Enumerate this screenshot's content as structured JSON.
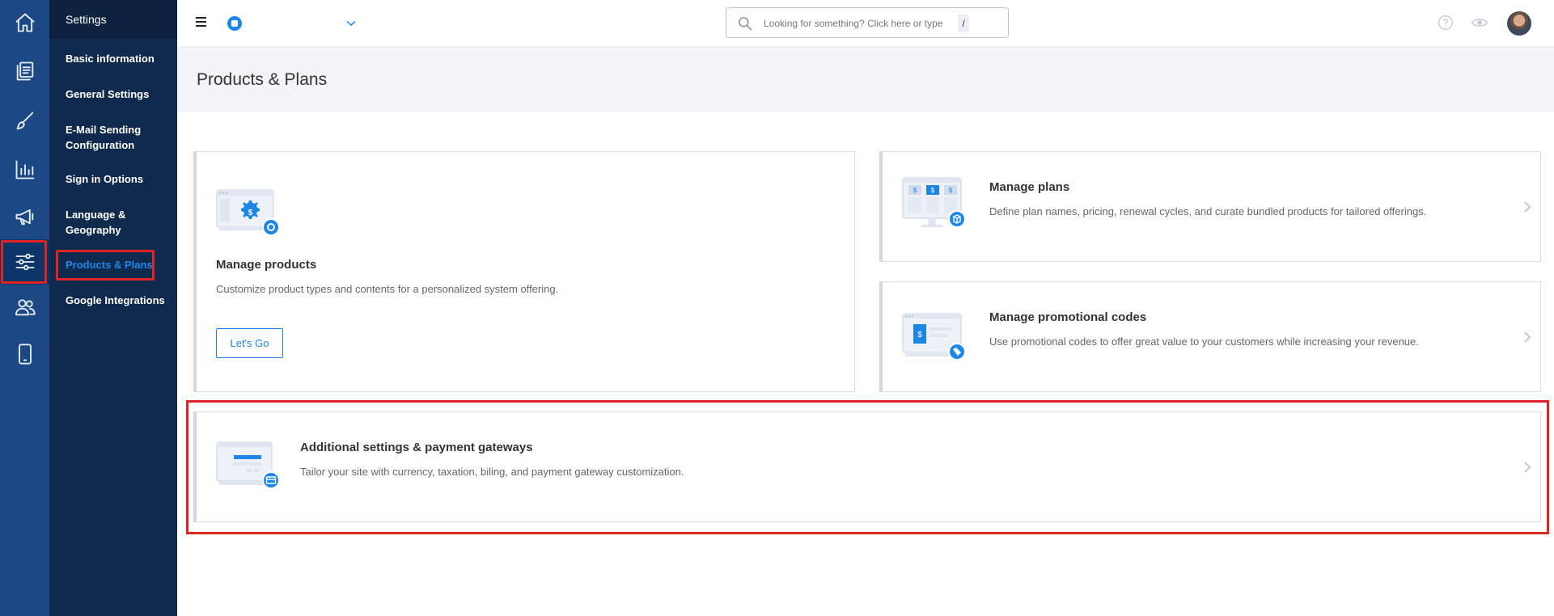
{
  "sidebar": {
    "header": "Settings",
    "items": [
      {
        "label": "Basic information"
      },
      {
        "label": "General Settings"
      },
      {
        "label": "E-Mail Sending Configuration"
      },
      {
        "label": "Sign in Options"
      },
      {
        "label": "Language & Geography"
      },
      {
        "label": "Products & Plans",
        "active": true
      },
      {
        "label": "Google Integrations"
      }
    ]
  },
  "rail": {
    "icons": [
      "home-icon",
      "pages-icon",
      "brush-icon",
      "analytics-icon",
      "megaphone-icon",
      "sliders-icon",
      "users-icon",
      "mobile-icon"
    ],
    "active": "sliders-icon"
  },
  "topbar": {
    "search_placeholder": "Looking for something? Click here or type",
    "search_shortcut": "/"
  },
  "page": {
    "title": "Products & Plans"
  },
  "cards": {
    "manage_products": {
      "title": "Manage products",
      "description": "Customize product types and contents for a personalized system offering.",
      "button": "Let's Go"
    },
    "manage_plans": {
      "title": "Manage plans",
      "description": "Define plan names, pricing, renewal cycles, and curate bundled products for tailored offerings."
    },
    "promo_codes": {
      "title": "Manage promotional codes",
      "description": "Use promotional codes to offer great value to your customers while increasing your revenue."
    },
    "additional_settings": {
      "title": "Additional settings & payment gateways",
      "description": "Tailor your site with currency, taxation, biling, and payment gateway customization."
    }
  },
  "colors": {
    "rail": "#1c4883",
    "sidebar": "#0f2a4d",
    "accent": "#1e86e6",
    "highlight": "#e02424"
  }
}
